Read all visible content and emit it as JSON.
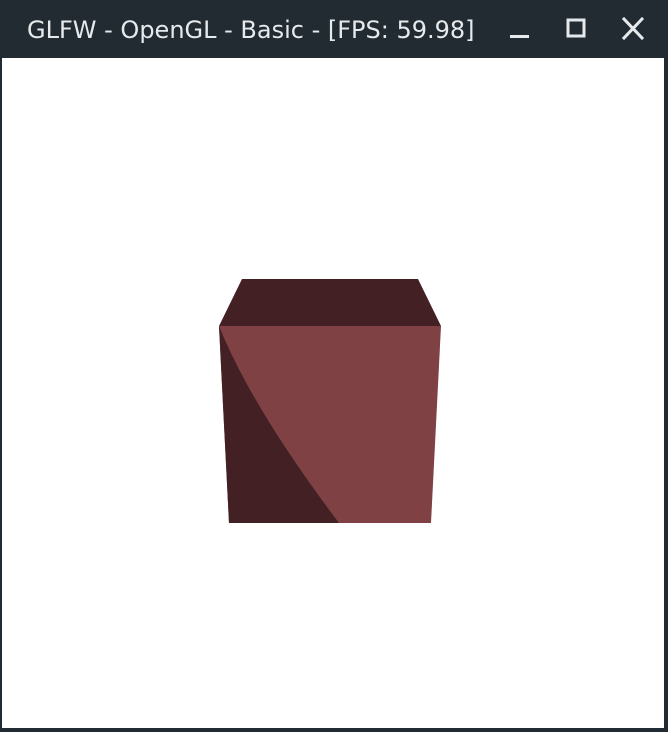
{
  "window": {
    "title": "GLFW - OpenGL - Basic - [FPS: 59.98]",
    "controls": {
      "minimize": "minimize-icon",
      "maximize": "maximize-icon",
      "close": "close-icon"
    }
  },
  "scene": {
    "background_color": "#ffffff",
    "object": "cube",
    "colors": {
      "top_face": "#432023",
      "front_face": "#7f4144",
      "shadow": "#432023"
    }
  },
  "theme": {
    "titlebar_color": "#222b31",
    "title_text_color": "#e6eaec"
  }
}
